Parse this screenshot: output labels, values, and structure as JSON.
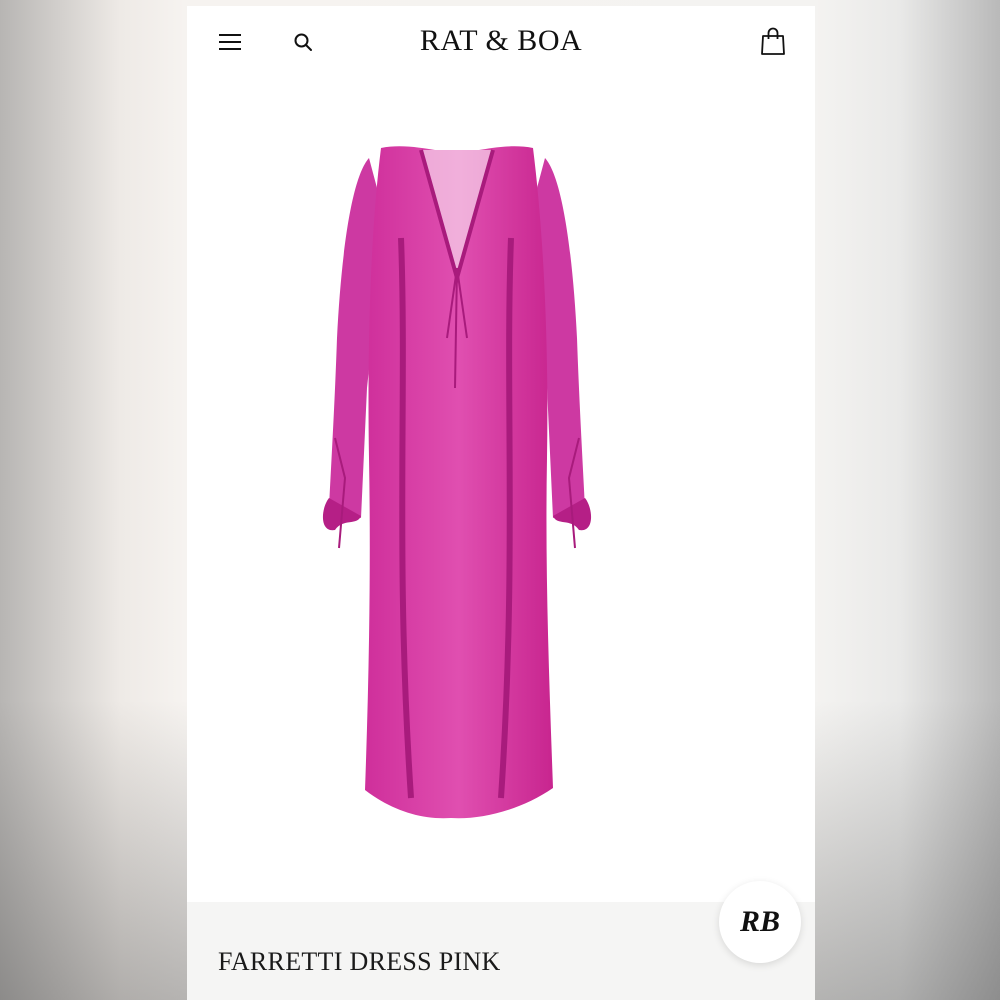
{
  "header": {
    "brand": "RAT & BOA",
    "menu_icon": "hamburger-menu-icon",
    "search_icon": "search-icon",
    "cart_icon": "shopping-bag-icon"
  },
  "product": {
    "title": "FARRETTI DRESS PINK",
    "image_alt": "Pink sheer long-sleeve ruffle maxi dress",
    "color": "#d4299a"
  },
  "chat_badge": {
    "monogram": "RB"
  }
}
